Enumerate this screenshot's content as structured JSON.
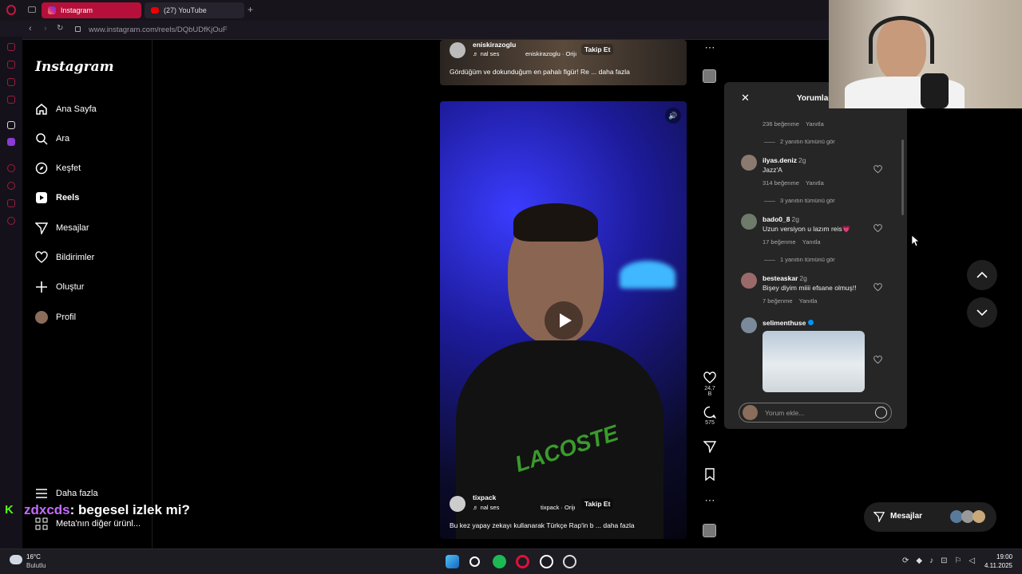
{
  "browser": {
    "tabs": [
      {
        "label": "Instagram"
      },
      {
        "label": "(27) YouTube"
      }
    ],
    "url": "www.instagram.com/reels/DQbUDfKjOuF"
  },
  "sidebar": {
    "logo": "Instagram",
    "items": [
      {
        "label": "Ana Sayfa",
        "icon": "home-icon"
      },
      {
        "label": "Ara",
        "icon": "search-icon"
      },
      {
        "label": "Keşfet",
        "icon": "compass-icon"
      },
      {
        "label": "Reels",
        "icon": "reels-icon"
      },
      {
        "label": "Mesajlar",
        "icon": "send-icon"
      },
      {
        "label": "Bildirimler",
        "icon": "heart-icon"
      },
      {
        "label": "Oluştur",
        "icon": "plus-icon"
      },
      {
        "label": "Profil",
        "icon": "avatar-icon"
      }
    ],
    "more": "Daha fazla",
    "meta": "Meta'nın diğer ürünl..."
  },
  "reel_top": {
    "user": "eniskirazoglu",
    "audio": "nal ses",
    "audio_src": "eniskirazoglu · Orijı",
    "follow": "Takip Et",
    "caption": "Gördüğüm ve dokunduğum en pahalı figür! Re ...",
    "more": "daha fazla"
  },
  "reel_main": {
    "user": "tixpack",
    "audio": "nal ses",
    "audio_src": "tixpack · Orijı",
    "follow": "Takip Et",
    "caption": "Bu kez yapay zekayı kullanarak Türkçe Rap'in b ...",
    "more": "daha fazla",
    "shirt_text": "LACOSTE"
  },
  "actions": {
    "likes": "24,7 B",
    "comments": "575"
  },
  "comments": {
    "title": "Yorumlar",
    "reply_label": "Yanıtla",
    "first_meta": "236 beğenme",
    "first_replies": "2 yanıtın tümünü gör",
    "items": [
      {
        "user": "ilyas.deniz",
        "time": "2g",
        "text": "Jazz'A",
        "likes": "314 beğenme",
        "replies": "3 yanıtın tümünü gör"
      },
      {
        "user": "bado0_8",
        "time": "2g",
        "text": "Uzun versiyon u lazım reis💗",
        "likes": "17 beğenme",
        "replies": "1 yanıtın tümünü gör"
      },
      {
        "user": "besteaskar",
        "time": "2g",
        "text": "Bişey diyim miiii efsane olmuş!!",
        "likes": "7 beğenme"
      },
      {
        "user": "selimenthuse"
      }
    ],
    "input_placeholder": "Yorum ekle..."
  },
  "messages_button": "Mesajlar",
  "chat_overlay": {
    "user": "zdxcds",
    "message": ": begesel izlek mi?"
  },
  "taskbar": {
    "temp": "16°C",
    "weather": "Bulutlu",
    "time": "19:00",
    "date": "4.11.2025"
  },
  "colors": {
    "accent": "#b6103a",
    "blue": "#0095f6"
  }
}
